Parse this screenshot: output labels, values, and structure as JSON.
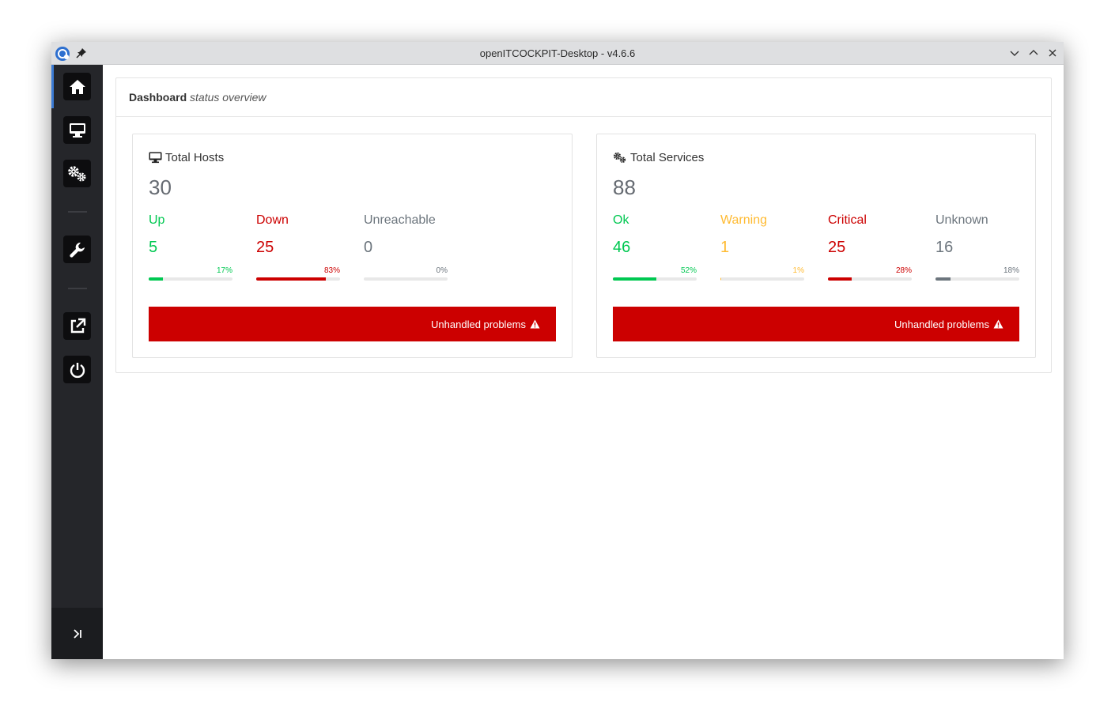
{
  "window": {
    "title": "openITCOCKPIT-Desktop - v4.6.6"
  },
  "sidebar": {
    "items": [
      {
        "name": "home",
        "icon": "home-icon",
        "active": true
      },
      {
        "name": "hosts",
        "icon": "desktop-icon"
      },
      {
        "name": "services",
        "icon": "cogs-icon"
      },
      {
        "name": "settings",
        "icon": "wrench-icon"
      },
      {
        "name": "open-external",
        "icon": "external-link-icon"
      },
      {
        "name": "power",
        "icon": "power-icon"
      }
    ],
    "footer_icon": "collapse-icon"
  },
  "dashboard": {
    "title": "Dashboard",
    "subtitle": "status overview",
    "hosts": {
      "title": "Total Hosts",
      "total": "30",
      "stats": [
        {
          "label": "Up",
          "count": "5",
          "percent_label": "17%",
          "percent": 17,
          "color": "#00c851"
        },
        {
          "label": "Down",
          "count": "25",
          "percent_label": "83%",
          "percent": 83,
          "color": "#cc0000"
        },
        {
          "label": "Unreachable",
          "count": "0",
          "percent_label": "0%",
          "percent": 0,
          "color": "#6c757d"
        }
      ],
      "button_label": "Unhandled problems"
    },
    "services": {
      "title": "Total Services",
      "total": "88",
      "stats": [
        {
          "label": "Ok",
          "count": "46",
          "percent_label": "52%",
          "percent": 52,
          "color": "#00c851"
        },
        {
          "label": "Warning",
          "count": "1",
          "percent_label": "1%",
          "percent": 1,
          "color": "#ffbb33"
        },
        {
          "label": "Critical",
          "count": "25",
          "percent_label": "28%",
          "percent": 28,
          "color": "#cc0000"
        },
        {
          "label": "Unknown",
          "count": "16",
          "percent_label": "18%",
          "percent": 18,
          "color": "#6c757d"
        }
      ],
      "button_label": "Unhandled problems"
    }
  },
  "colors": {
    "accent": "#3b7bd4",
    "danger": "#cc0000",
    "sidebar": "#25262a"
  }
}
